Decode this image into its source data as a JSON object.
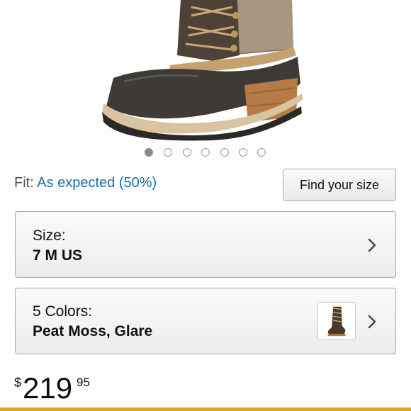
{
  "carousel": {
    "count": 7,
    "active_index": 0
  },
  "fit": {
    "label": "Fit:",
    "value": "As expected (50%)"
  },
  "find_size_button": {
    "label": "Find your size"
  },
  "size_option": {
    "label": "Size:",
    "value": "7 M US"
  },
  "color_option": {
    "label": "5 Colors:",
    "value": "Peat Moss, Glare"
  },
  "price": {
    "currency": "$",
    "whole": "219",
    "fraction": "95"
  },
  "icons": {
    "chevron": "chevron-right-icon"
  },
  "colors": {
    "link": "#1a6ea8",
    "accent_bar": "#d9a72a"
  }
}
